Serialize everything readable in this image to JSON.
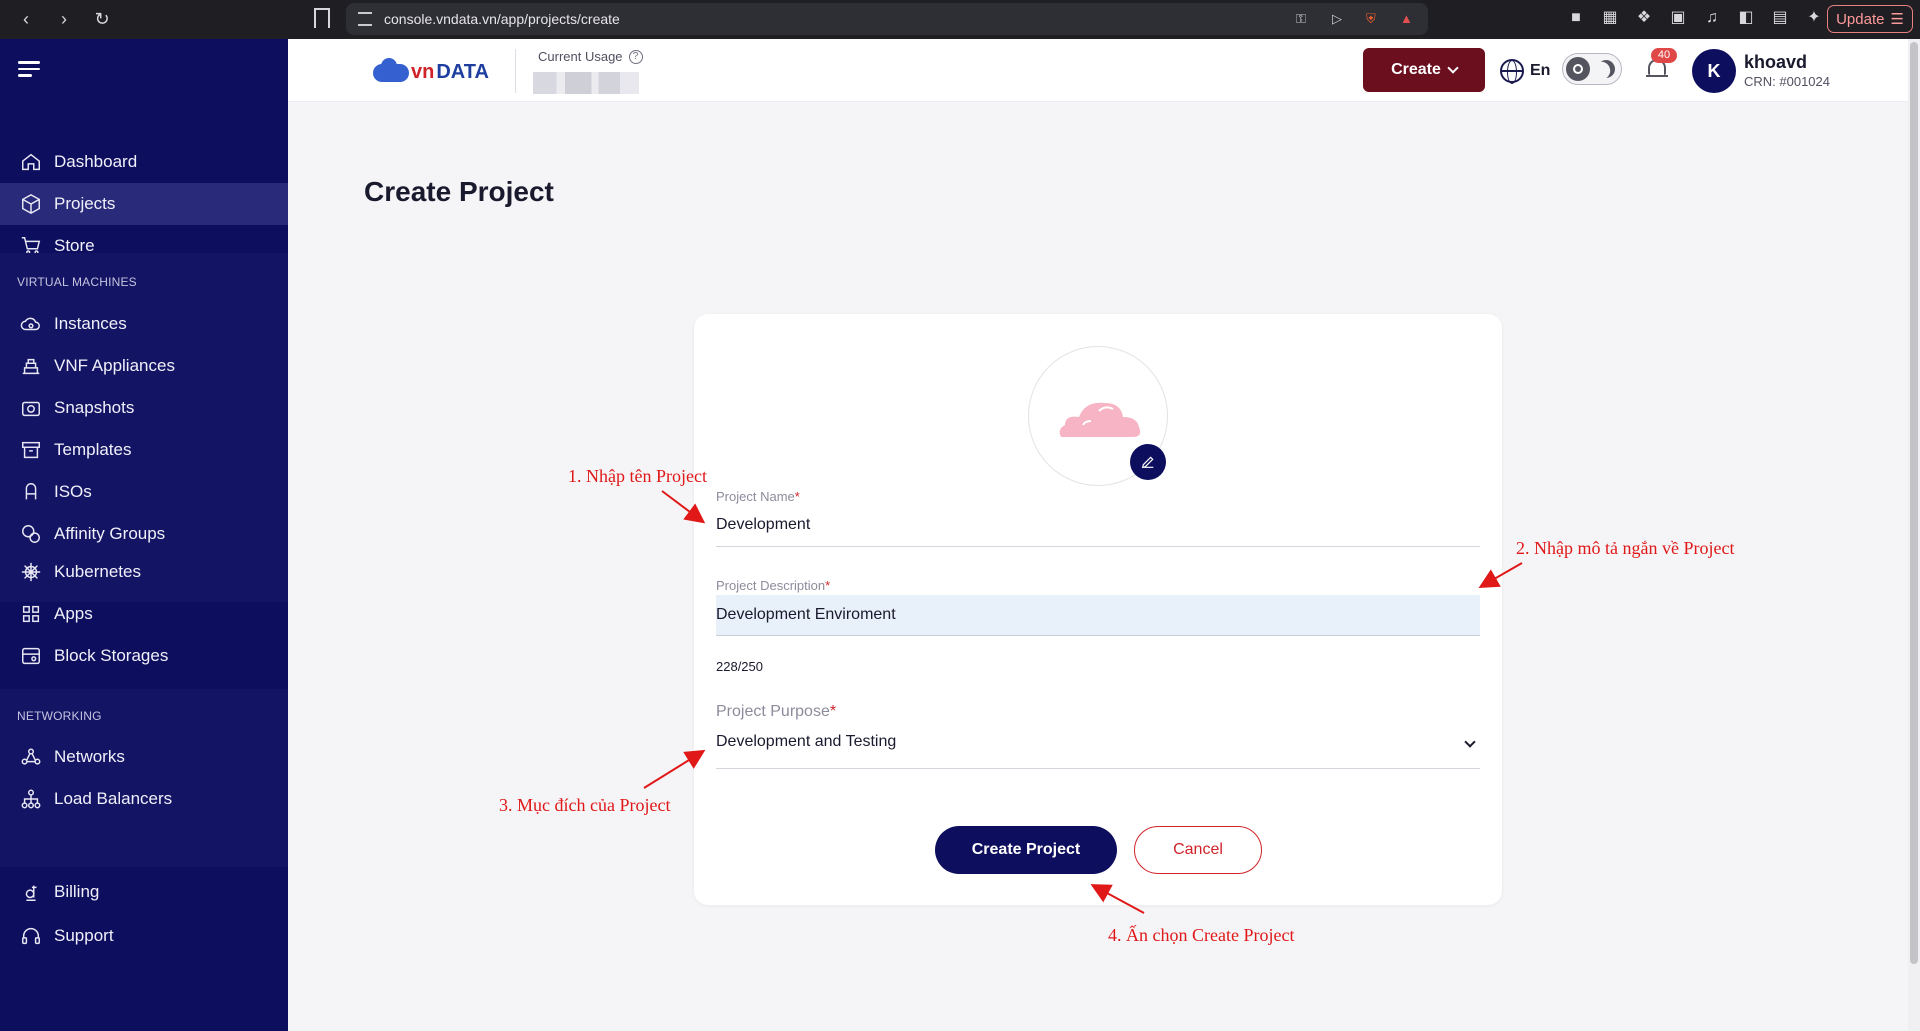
{
  "browser": {
    "url": "console.vndata.vn/app/projects/create",
    "update_label": "Update"
  },
  "sidebar": {
    "main": [
      {
        "label": "Dashboard",
        "icon": "home-icon"
      },
      {
        "label": "Projects",
        "icon": "cube-icon",
        "active": true
      },
      {
        "label": "Store",
        "icon": "cart-icon"
      }
    ],
    "vm_section_label": "VIRTUAL MACHINES",
    "vm": [
      {
        "label": "Instances",
        "icon": "cloud-icon"
      },
      {
        "label": "VNF Appliances",
        "icon": "firewall-icon"
      },
      {
        "label": "Snapshots",
        "icon": "camera-icon"
      },
      {
        "label": "Templates",
        "icon": "archive-icon"
      },
      {
        "label": "ISOs",
        "icon": "disc-icon"
      },
      {
        "label": "Affinity Groups",
        "icon": "group-icon"
      }
    ],
    "k8s": [
      {
        "label": "Kubernetes",
        "icon": "helm-icon"
      },
      {
        "label": "Apps",
        "icon": "apps-icon"
      },
      {
        "label": "Block Storages",
        "icon": "storage-icon"
      }
    ],
    "net_section_label": "NETWORKING",
    "net": [
      {
        "label": "Networks",
        "icon": "network-icon"
      },
      {
        "label": "Load Balancers",
        "icon": "balancer-icon"
      }
    ],
    "bottom": [
      {
        "label": "Billing",
        "icon": "dong-icon"
      },
      {
        "label": "Support",
        "icon": "headset-icon"
      }
    ]
  },
  "header": {
    "logo_text_vn": "vn",
    "logo_text_data": "DATA",
    "usage_label": "Current Usage",
    "create_label": "Create",
    "lang_label": "En",
    "notification_count": "40",
    "avatar_initial": "K",
    "user_name": "khoavd",
    "user_crn": "CRN: #001024"
  },
  "page": {
    "title": "Create Project"
  },
  "form": {
    "name_label": "Project Name",
    "name_value": "Development",
    "desc_label": "Project Description",
    "desc_value": "Development Enviroment",
    "counter": "228/250",
    "purpose_label": "Project Purpose",
    "purpose_value": "Development and Testing",
    "required_mark": "*",
    "submit_label": "Create Project",
    "cancel_label": "Cancel"
  },
  "annotations": [
    "1. Nhập tên Project",
    "2. Nhập mô tả ngắn về Project",
    "3. Mục đích của Project",
    "4. Ấn chọn Create Project"
  ],
  "colors": {
    "sidebar_bg": "#0e0e5e",
    "create_button": "#6b0e1e",
    "primary": "#0e0e5e",
    "danger": "#d0232a",
    "annotation": "#e01818"
  }
}
